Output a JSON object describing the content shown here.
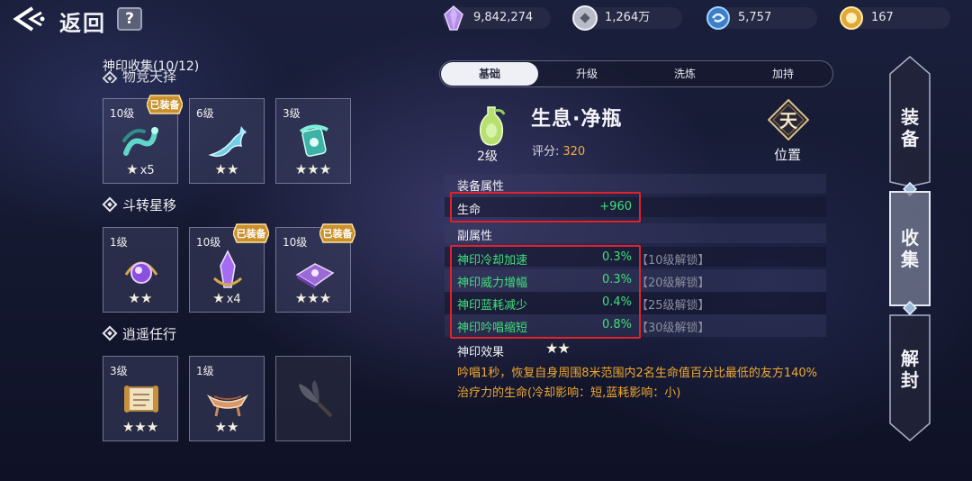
{
  "header": {
    "back_label": "返回",
    "help_label": "?",
    "currencies": [
      {
        "icon": "purple-crystal-icon",
        "value": "9,842,274"
      },
      {
        "icon": "silver-coin-icon",
        "value": "1,264万"
      },
      {
        "icon": "blue-swirl-icon",
        "value": "5,757"
      },
      {
        "icon": "gold-gem-icon",
        "value": "167"
      }
    ]
  },
  "collection": {
    "title": "神印收集(10/12)",
    "cut_section": "物竞天择",
    "equipped_label": "已装备",
    "sections": [
      {
        "name": "",
        "items": [
          {
            "level": "10级",
            "stars": "★",
            "count": "x5",
            "equipped": true,
            "art": "jade-serpent-icon"
          },
          {
            "level": "6级",
            "stars": "★★",
            "count": "",
            "equipped": false,
            "art": "crystal-fish-tail-icon"
          },
          {
            "level": "3级",
            "stars": "★★★",
            "count": "",
            "equipped": false,
            "art": "jade-dragon-icon"
          }
        ]
      },
      {
        "name": "斗转星移",
        "items": [
          {
            "level": "1级",
            "stars": "★★",
            "count": "",
            "equipped": false,
            "art": "violet-orb-icon"
          },
          {
            "level": "10级",
            "stars": "★",
            "count": "x4",
            "equipped": true,
            "art": "violet-crystal-icon"
          },
          {
            "level": "10级",
            "stars": "★★★",
            "count": "",
            "equipped": true,
            "art": "purple-cushion-icon"
          }
        ]
      },
      {
        "name": "逍遥任行",
        "items": [
          {
            "level": "3级",
            "stars": "★★★",
            "count": "",
            "equipped": false,
            "art": "scroll-icon"
          },
          {
            "level": "1级",
            "stars": "★★",
            "count": "",
            "equipped": false,
            "art": "wooden-boat-icon"
          },
          {
            "level": "",
            "stars": "",
            "count": "",
            "equipped": false,
            "art": "whisk-icon"
          }
        ]
      }
    ]
  },
  "tabs": [
    "基础",
    "升级",
    "洗炼",
    "加持"
  ],
  "detail": {
    "level": "2级",
    "name": "生息·净瓶",
    "score_label": "评分:",
    "score_value": "320",
    "slot_char": "天",
    "slot_label": "位置",
    "equip_attr_title": "装备属性",
    "main_stat": {
      "name": "生命",
      "value": "+960"
    },
    "sub_attr_title": "副属性",
    "sub_stats": [
      {
        "name": "神印冷却加速",
        "value": "0.3%",
        "lock": "【10级解锁】"
      },
      {
        "name": "神印威力增幅",
        "value": "0.3%",
        "lock": "【20级解锁】"
      },
      {
        "name": "神印蓝耗减少",
        "value": "0.4%",
        "lock": "【25级解锁】"
      },
      {
        "name": "神印吟唱缩短",
        "value": "0.8%",
        "lock": "【30级解锁】"
      }
    ],
    "effect_title": "神印效果",
    "effect_stars": "★★",
    "effect_text": "吟唱1秒，恢复自身周围8米范围内2名生命值百分比最低的友方140%治疗力的生命(冷却影响：短,蓝耗影响：小)"
  },
  "side_nav": {
    "equip": "装备",
    "collect": "收集",
    "unseal": "解封"
  },
  "colors": {
    "stat_green": "#3ee07a",
    "effect_orange": "#f0a830",
    "score_gold": "#f0b040",
    "highlight_red": "#e2222a"
  }
}
